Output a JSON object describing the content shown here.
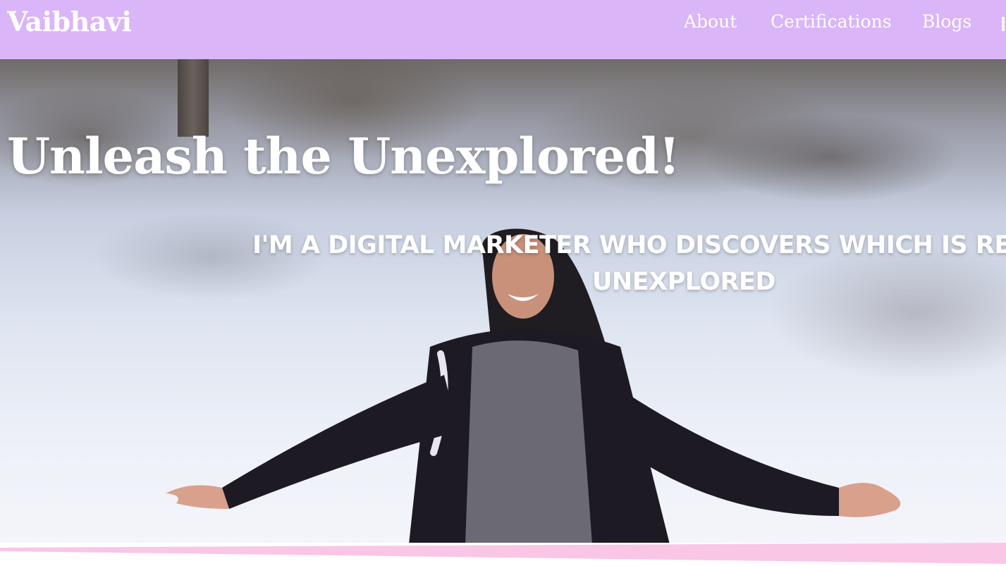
{
  "brand": "Vaibhavi",
  "nav": {
    "about": "About",
    "certifications": "Certifications",
    "blogs": "Blogs"
  },
  "hero": {
    "title": "Unleash the Unexplored!",
    "subtitle": "I'm a Digital Marketer who discovers which is required unexplored"
  },
  "colors": {
    "navbar": "#dab5f7",
    "text": "#ffffff",
    "accent_band": "#f9c6e6"
  }
}
